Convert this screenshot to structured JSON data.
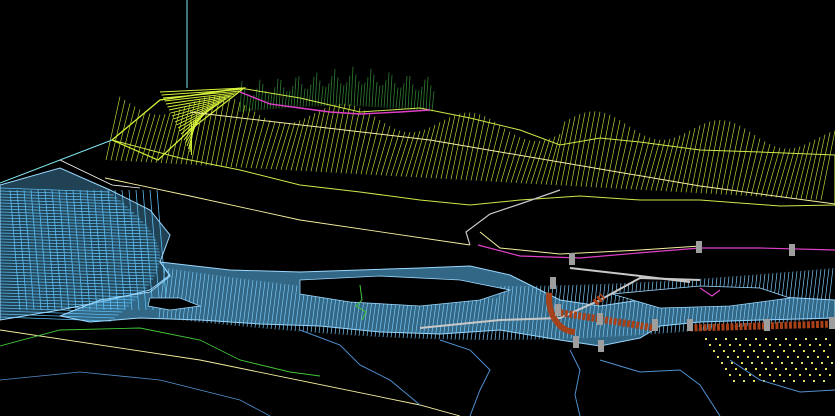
{
  "scene": {
    "background_color": "#000000",
    "description_free": true,
    "layers": {
      "terrain_far": {
        "color": "#2e7d32"
      },
      "terrain_slope": {
        "color": "#b5d334"
      },
      "terrain_slope_bright": {
        "color": "#d7f23a"
      },
      "river_water": {
        "color": "#5bbcf2"
      },
      "river_water_edge": {
        "color": "#9ad8ff"
      },
      "road_lines": {
        "color": "#c8c8c8"
      },
      "survey_lines": {
        "color": "#f6f0a0"
      },
      "boundary_magenta": {
        "color": "#e040c8"
      },
      "axis_cyan": {
        "color": "#7fe6f0"
      },
      "dam_structure": {
        "color": "#a84018"
      },
      "piers": {
        "color": "#9e9e9e"
      },
      "yellow_markers": {
        "color": "#e6e05a"
      },
      "ground_contours_green": {
        "color": "#44c63a"
      },
      "stream_lines_blue": {
        "color": "#4f8fcf"
      }
    }
  }
}
